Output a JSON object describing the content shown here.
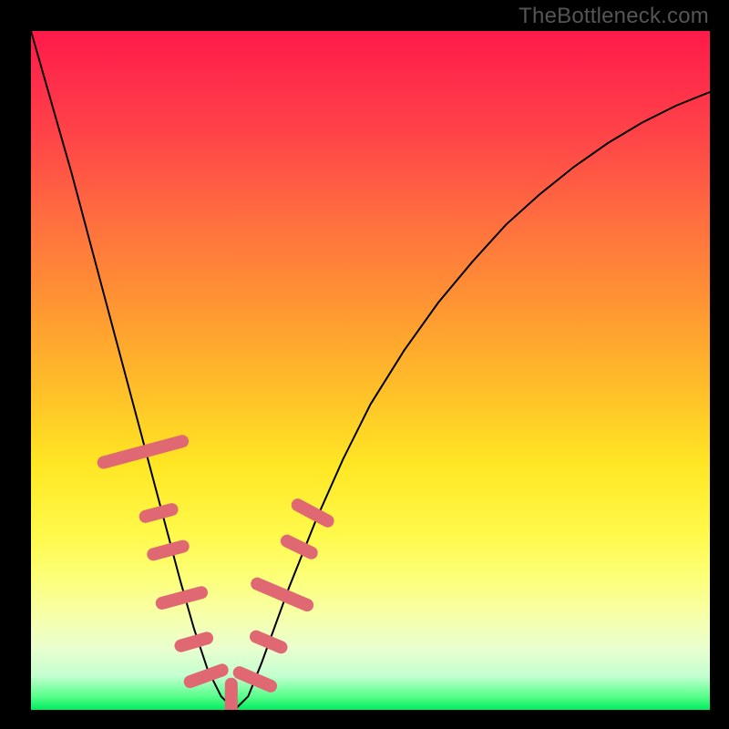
{
  "watermark": "TheBottleneck.com",
  "chart_data": {
    "type": "line",
    "title": "",
    "xlabel": "",
    "ylabel": "",
    "xlim": [
      0,
      100
    ],
    "ylim": [
      0,
      100
    ],
    "grid": false,
    "legend": false,
    "series": [
      {
        "name": "bottleneck-curve",
        "x": [
          0,
          2,
          4,
          6,
          8,
          10,
          12,
          14,
          16,
          18,
          20,
          22,
          24,
          26,
          28,
          30,
          32,
          34,
          38,
          42,
          46,
          50,
          55,
          60,
          65,
          70,
          75,
          80,
          85,
          90,
          95,
          100
        ],
        "y": [
          100,
          93,
          86,
          79,
          71.5,
          64,
          56.5,
          49,
          41.5,
          34,
          26.5,
          19,
          12,
          6,
          2,
          0,
          2,
          7,
          18,
          28,
          37,
          45,
          53,
          60,
          66,
          71.5,
          76,
          80,
          83.5,
          86.5,
          89,
          91
        ],
        "color": "#000000",
        "width": 2
      }
    ],
    "markers": {
      "name": "highlighted-segments",
      "color": "#e06873",
      "points": [
        {
          "x": 16.5,
          "y": 38,
          "len": 12,
          "angle": 75
        },
        {
          "x": 18.8,
          "y": 29,
          "len": 4,
          "angle": 75
        },
        {
          "x": 20.2,
          "y": 23.5,
          "len": 4.5,
          "angle": 75
        },
        {
          "x": 22.2,
          "y": 16.5,
          "len": 6,
          "angle": 75
        },
        {
          "x": 24.0,
          "y": 10,
          "len": 4,
          "angle": 74
        },
        {
          "x": 25.8,
          "y": 5,
          "len": 5,
          "angle": 70
        },
        {
          "x": 29.5,
          "y": 0.8,
          "len": 6,
          "angle": 0
        },
        {
          "x": 33.0,
          "y": 4.5,
          "len": 5,
          "angle": -67
        },
        {
          "x": 35.0,
          "y": 10,
          "len": 4,
          "angle": -67
        },
        {
          "x": 37.0,
          "y": 17,
          "len": 8,
          "angle": -67
        },
        {
          "x": 39.5,
          "y": 24,
          "len": 4,
          "angle": -64
        },
        {
          "x": 41.5,
          "y": 29,
          "len": 5,
          "angle": -62
        }
      ]
    },
    "background": {
      "type": "vertical-gradient",
      "stops": [
        {
          "pos": 0.0,
          "color": "#ff1a4a"
        },
        {
          "pos": 0.4,
          "color": "#ff9433"
        },
        {
          "pos": 0.74,
          "color": "#fff94a"
        },
        {
          "pos": 0.95,
          "color": "#c4ffd0"
        },
        {
          "pos": 1.0,
          "color": "#00ec5e"
        }
      ]
    }
  }
}
